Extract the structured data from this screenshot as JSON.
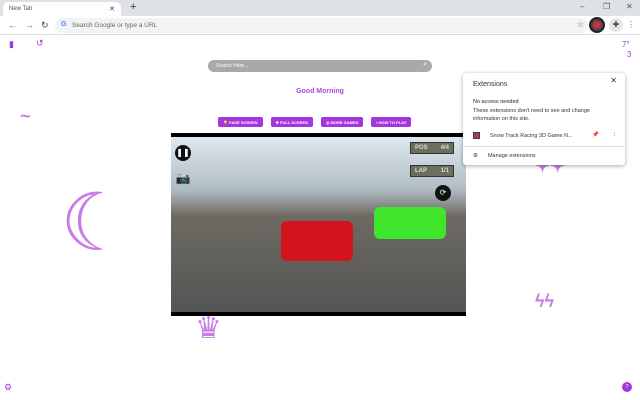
{
  "browser": {
    "tab_title": "New Tab",
    "omnibox_placeholder": "Search Google or type a URL"
  },
  "page": {
    "search_placeholder": "Search Here...",
    "greeting": "Good Morning",
    "buttons": [
      {
        "label": "FADE SCREEN",
        "icon": "bulb"
      },
      {
        "label": "FULL SCREEN",
        "icon": "arrows"
      },
      {
        "label": "MORE GAMES",
        "icon": "gamepad"
      },
      {
        "label": "HOW TO PLAY",
        "icon": "info"
      }
    ],
    "weather_temp": "7°",
    "weather_small": "3"
  },
  "game": {
    "pos_label": "POS",
    "pos_value": "4/4",
    "lap_label": "LAP",
    "lap_value": "1/1"
  },
  "extensions_popup": {
    "title": "Extensions",
    "section": "No access needed",
    "description": "These extensions don't need to see and change information on this site.",
    "item": "Snow Track Racing 3D Game N...",
    "manage": "Manage extensions"
  },
  "colors": {
    "accent": "#a436e0"
  }
}
